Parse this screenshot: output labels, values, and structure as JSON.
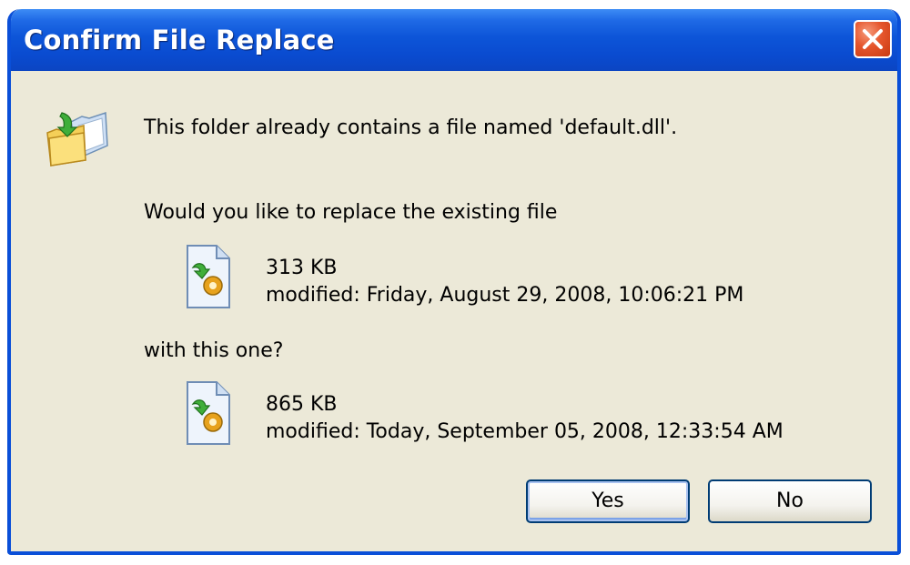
{
  "window": {
    "title": "Confirm File Replace"
  },
  "message": {
    "line1": "This folder already contains a file named 'default.dll'.",
    "line2": "Would you like to replace the existing file",
    "line3": "with this one?"
  },
  "existing_file": {
    "size": "313 KB",
    "modified": "modified: Friday, August 29, 2008, 10:06:21 PM"
  },
  "new_file": {
    "size": "865 KB",
    "modified": "modified: Today, September 05, 2008, 12:33:54 AM"
  },
  "buttons": {
    "yes": "Yes",
    "no": "No"
  },
  "icons": {
    "dialog": "folder-move-icon",
    "file": "dll-file-icon",
    "close": "close-icon"
  },
  "colors": {
    "titlebar": "#0a4fd8",
    "dialog_bg": "#ece9d8",
    "close_button": "#e5552c"
  }
}
